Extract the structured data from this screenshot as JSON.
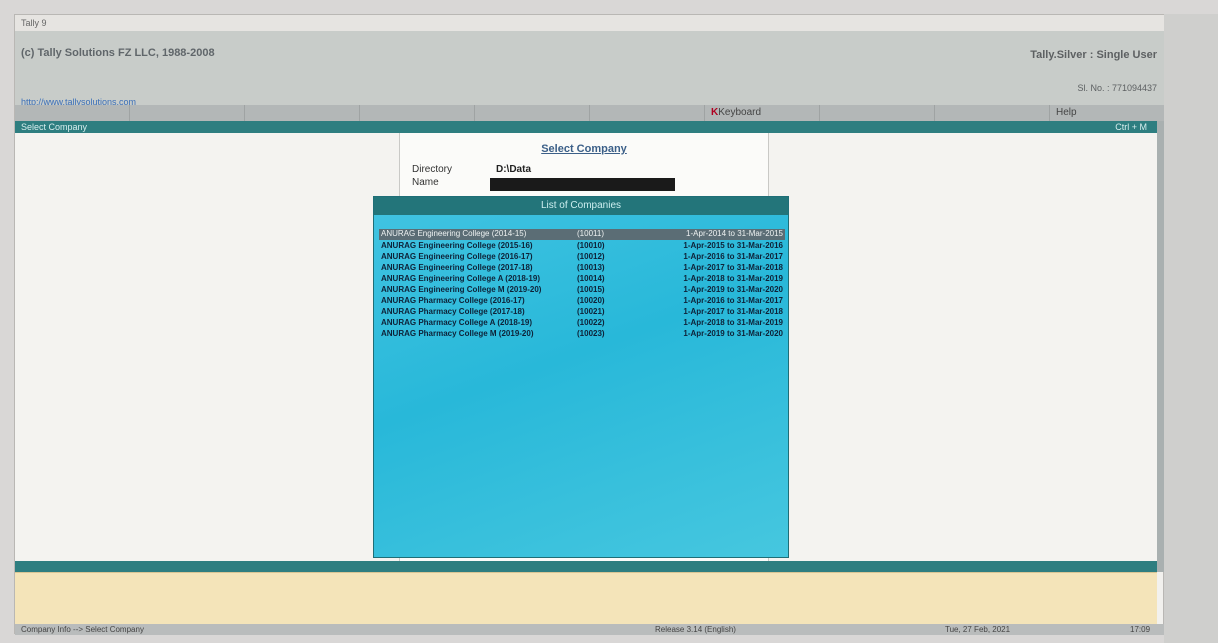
{
  "window": {
    "title": "Tally 9"
  },
  "header": {
    "copyright": "(c) Tally Solutions FZ LLC, 1988-2008",
    "website": "http://www.tallysolutions.com",
    "edition": "Tally.Silver : Single User",
    "serial": "Sl. No. : 771094437"
  },
  "menubar": {
    "items": [
      {
        "key": "",
        "label": ""
      },
      {
        "key": "",
        "label": ""
      },
      {
        "key": "",
        "label": ""
      },
      {
        "key": "",
        "label": ""
      },
      {
        "key": "",
        "label": ""
      },
      {
        "key": "",
        "label": ""
      },
      {
        "key": "K",
        "label": "Keyboard"
      },
      {
        "key": "",
        "label": ""
      },
      {
        "key": "",
        "label": ""
      },
      {
        "key": "",
        "label": "Help"
      }
    ]
  },
  "title_strip": {
    "left": "Select Company",
    "right": "Ctrl + M"
  },
  "select_company": {
    "title": "Select Company",
    "directory_label": "Directory",
    "directory_value": "D:\\Data",
    "name_label": "Name"
  },
  "company_list": {
    "header": "List of Companies",
    "columns": [
      "ANURAG Engineering College (2014-15)",
      "(10011)",
      "1-Apr-2014 to 31-Mar-2015"
    ],
    "rows": [
      [
        "ANURAG Engineering College (2015-16)",
        "(10010)",
        "1-Apr-2015 to 31-Mar-2016"
      ],
      [
        "ANURAG Engineering College (2016-17)",
        "(10012)",
        "1-Apr-2016 to 31-Mar-2017"
      ],
      [
        "ANURAG Engineering College (2017-18)",
        "(10013)",
        "1-Apr-2017 to 31-Mar-2018"
      ],
      [
        "ANURAG Engineering College A (2018-19)",
        "(10014)",
        "1-Apr-2018 to 31-Mar-2019"
      ],
      [
        "ANURAG Engineering College M (2019-20)",
        "(10015)",
        "1-Apr-2019 to 31-Mar-2020"
      ],
      [
        "ANURAG Pharmacy College (2016-17)",
        "(10020)",
        "1-Apr-2016 to 31-Mar-2017"
      ],
      [
        "ANURAG Pharmacy College (2017-18)",
        "(10021)",
        "1-Apr-2017 to 31-Mar-2018"
      ],
      [
        "ANURAG Pharmacy College A (2018-19)",
        "(10022)",
        "1-Apr-2018 to 31-Mar-2019"
      ],
      [
        "ANURAG Pharmacy College M (2019-20)",
        "(10023)",
        "1-Apr-2019 to 31-Mar-2020"
      ]
    ]
  },
  "status_bar": {
    "path": "Company Info --> Select Company",
    "release": "Release 3.14 (English)",
    "date": "Tue, 27 Feb, 2021",
    "time": "17:09"
  },
  "colors": {
    "teal": "#2e7e80",
    "list_bg": "#28b8d9",
    "calculator_bg": "#f4e4b9"
  }
}
